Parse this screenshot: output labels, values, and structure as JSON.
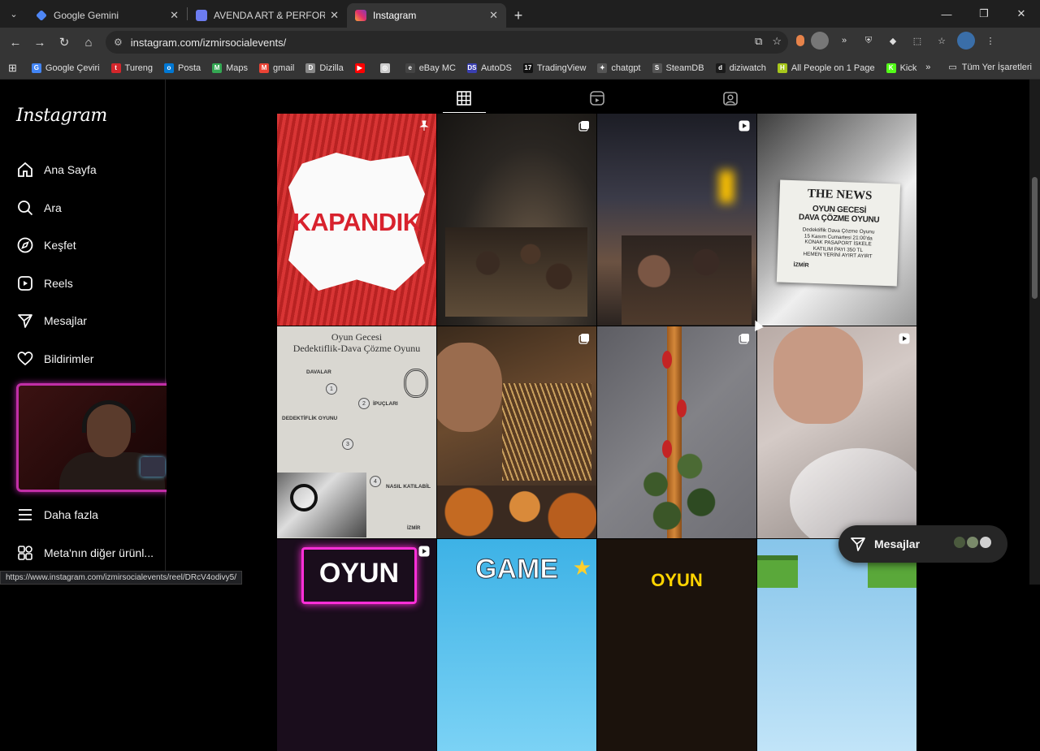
{
  "browser": {
    "tabs": [
      {
        "title": "Google Gemini",
        "color": "#4e86f5"
      },
      {
        "title": "AVENDA ART & PERFORMANCE",
        "color": "#6c7cf0"
      },
      {
        "title": "Instagram",
        "color": "#e1306c"
      }
    ],
    "url": "instagram.com/izmirsocialevents/",
    "bookmarks": [
      {
        "label": "Google Çeviri",
        "color": "#4285f4",
        "glyph": "G"
      },
      {
        "label": "Tureng",
        "color": "#d3262b",
        "glyph": "t"
      },
      {
        "label": "Posta",
        "color": "#0078d4",
        "glyph": "o"
      },
      {
        "label": "Maps",
        "color": "#34a853",
        "glyph": "M"
      },
      {
        "label": "gmail",
        "color": "#ea4335",
        "glyph": "M"
      },
      {
        "label": "Dizilla",
        "color": "#888888",
        "glyph": "D"
      },
      {
        "label": "",
        "color": "#ff0000",
        "glyph": "▶"
      },
      {
        "label": "",
        "color": "#cccccc",
        "glyph": "◎"
      },
      {
        "label": "eBay MC",
        "color": "#444444",
        "glyph": "e"
      },
      {
        "label": "AutoDS",
        "color": "#3a3fb0",
        "glyph": "DS"
      },
      {
        "label": "TradingView",
        "color": "#111111",
        "glyph": "17"
      },
      {
        "label": "chatgpt",
        "color": "#555555",
        "glyph": "✦"
      },
      {
        "label": "SteamDB",
        "color": "#555555",
        "glyph": "S"
      },
      {
        "label": "diziwatch",
        "color": "#1a1a1a",
        "glyph": "d"
      },
      {
        "label": "All People on 1 Page",
        "color": "#a6c61b",
        "glyph": "H"
      },
      {
        "label": "Kick",
        "color": "#53fc18",
        "glyph": "K"
      }
    ],
    "bookmarks_folder": "Tüm Yer İşaretleri",
    "status_url": "https://www.instagram.com/izmirsocialevents/reel/DRcV4odivy5/"
  },
  "sidebar": {
    "logo": "Instagram",
    "items": [
      {
        "label": "Ana Sayfa",
        "icon": "home-icon"
      },
      {
        "label": "Ara",
        "icon": "search-icon"
      },
      {
        "label": "Keşfet",
        "icon": "compass-icon"
      },
      {
        "label": "Reels",
        "icon": "reels-icon"
      },
      {
        "label": "Mesajlar",
        "icon": "paper-plane-icon"
      },
      {
        "label": "Bildirimler",
        "icon": "heart-icon"
      }
    ],
    "more": "Daha fazla",
    "meta": "Meta'nın diğer ürünl..."
  },
  "profile_tabs": [
    "grid-icon",
    "reels-tab-icon",
    "tagged-icon"
  ],
  "posts": {
    "p1": {
      "text": "KAPANDIK",
      "badge": "pin-icon"
    },
    "p2": {
      "badge": "carousel-icon"
    },
    "p3": {
      "badge": "reel-icon"
    },
    "p4": {
      "head": "THE NEWS",
      "sub1": "OYUN GECESİ",
      "sub2": "DAVA ÇÖZME OYUNU",
      "d1": "Dedektiflik Dava Çözme Oyunu",
      "d2": "15 Kasım Cumartesi 21:00'da",
      "d3": "KONAK PASAPORT İSKELE",
      "d4": "KATILIM PAYI 350 TL",
      "d5": "HEMEN YERİNİ AYIRT AYIRT",
      "logo": "İZMİR"
    },
    "p5": {
      "t1": "Oyun Gecesi",
      "t2": "Dedektiflik-Dava Çözme Oyunu",
      "s1": "DAVALAR",
      "s2": "İPUÇLARI",
      "s3": "DEDEKTİFLİK OYUNU",
      "s4": "NASIL KATILABİL",
      "n1": "1",
      "n2": "2",
      "n3": "3",
      "n4": "4",
      "brand": "İZMİR"
    },
    "p6": {
      "badge": "carousel-icon"
    },
    "p7": {
      "badge": "carousel-icon"
    },
    "p8": {
      "badge": "reel-icon"
    },
    "p9": {
      "text": "OYUN",
      "badge": "reel-icon"
    },
    "p10": {
      "text": "GAME"
    },
    "p11": {
      "text": "OYUN"
    },
    "p12": {}
  },
  "messages_float": {
    "label": "Mesajlar"
  }
}
